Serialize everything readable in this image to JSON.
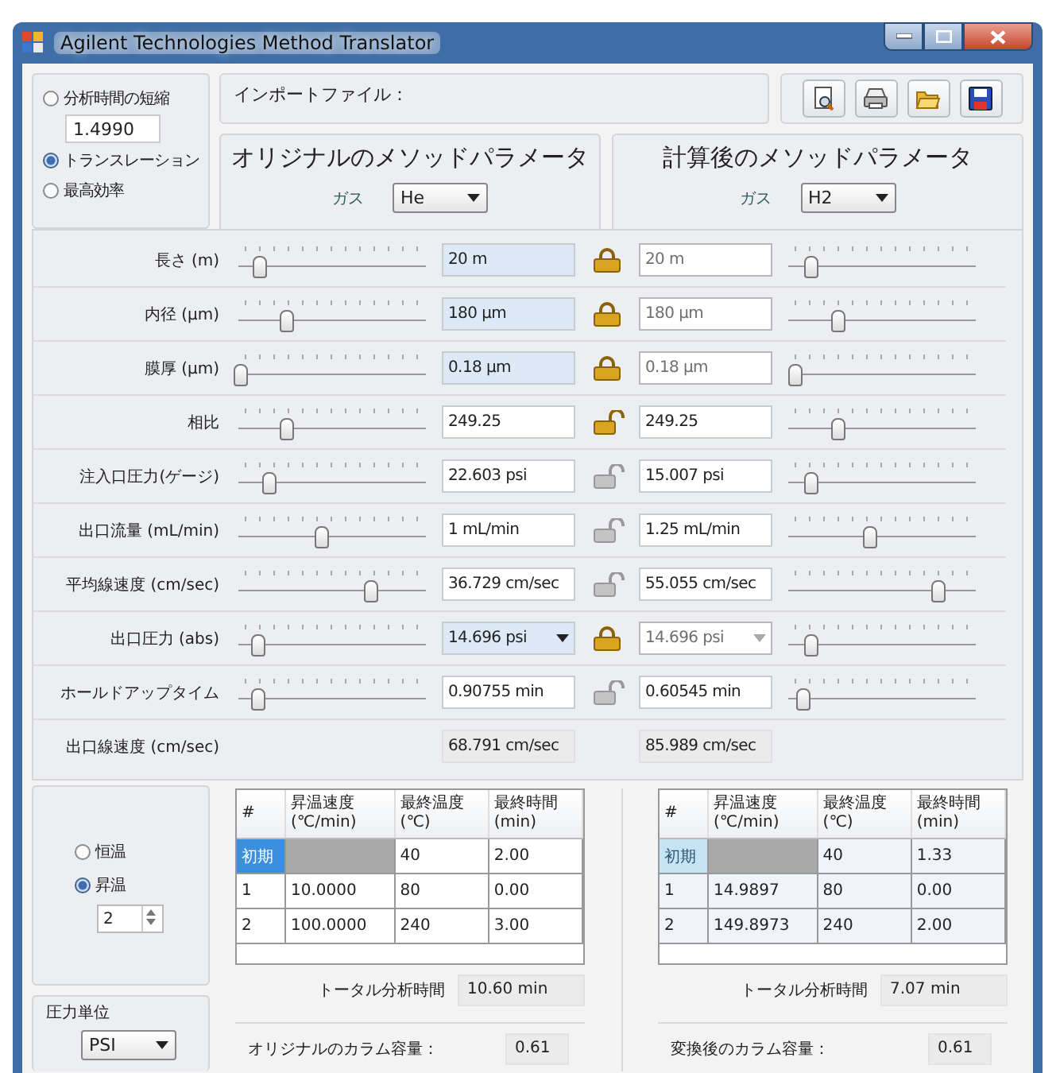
{
  "window": {
    "title": "Agilent Technologies Method Translator"
  },
  "mode_options": [
    {
      "label": "分析時間の短縮",
      "selected": false
    },
    {
      "label": "トランスレーション",
      "selected": true
    },
    {
      "label": "最高効率",
      "selected": false
    }
  ],
  "speed_factor": "1.4990",
  "import_file": {
    "label": "インポートファイル："
  },
  "toolbar": [
    {
      "kind": "preview"
    },
    {
      "kind": "print"
    },
    {
      "kind": "open"
    },
    {
      "kind": "save"
    }
  ],
  "original": {
    "title": "オリジナルのメソッドパラメータ",
    "gas_label": "ガス",
    "gas": "He"
  },
  "calculated": {
    "title": "計算後のメソッドパラメータ",
    "gas_label": "ガス",
    "gas": "H2"
  },
  "parameters": [
    {
      "kind": "slider",
      "label": "長さ (m)",
      "original": {
        "value": "20 m",
        "level": 0.11,
        "highlighted": true
      },
      "locked": true,
      "lock_disabled": false,
      "calculated": {
        "value": "20 m",
        "level": 0.12,
        "disabled": true
      }
    },
    {
      "kind": "slider",
      "label": "内径 (μm)",
      "original": {
        "value": "180 μm",
        "level": 0.25,
        "highlighted": true
      },
      "locked": true,
      "lock_disabled": false,
      "calculated": {
        "value": "180 μm",
        "level": 0.26,
        "disabled": true
      }
    },
    {
      "kind": "slider",
      "label": "膜厚 (μm)",
      "original": {
        "value": "0.18 μm",
        "level": 0.01,
        "highlighted": true
      },
      "locked": true,
      "lock_disabled": false,
      "calculated": {
        "value": "0.18 μm",
        "level": 0.03,
        "disabled": true
      }
    },
    {
      "kind": "slider",
      "label": "相比",
      "original": {
        "value": "249.25",
        "level": 0.25,
        "highlighted": false
      },
      "locked": false,
      "lock_disabled": false,
      "calculated": {
        "value": "249.25",
        "level": 0.26,
        "disabled": false
      }
    },
    {
      "kind": "slider",
      "label": "注入口圧力(ゲージ)",
      "original": {
        "value": "22.603 psi",
        "level": 0.16,
        "highlighted": false
      },
      "locked": false,
      "lock_disabled": true,
      "calculated": {
        "value": "15.007 psi",
        "level": 0.12,
        "disabled": false
      }
    },
    {
      "kind": "slider",
      "label": "出口流量 (mL/min)",
      "original": {
        "value": "1 mL/min",
        "level": 0.44,
        "highlighted": false
      },
      "locked": false,
      "lock_disabled": true,
      "calculated": {
        "value": "1.25 mL/min",
        "level": 0.43,
        "disabled": false
      }
    },
    {
      "kind": "slider",
      "label": "平均線速度 (cm/sec)",
      "original": {
        "value": "36.729 cm/sec",
        "level": 0.7,
        "highlighted": false
      },
      "locked": false,
      "lock_disabled": true,
      "calculated": {
        "value": "55.055 cm/sec",
        "level": 0.8,
        "disabled": false
      }
    },
    {
      "kind": "dropdown",
      "label": "出口圧力 (abs)",
      "original": {
        "value": "14.696 psi",
        "level": 0.1,
        "highlighted": true
      },
      "locked": true,
      "lock_disabled": false,
      "calculated": {
        "value": "14.696 psi",
        "level": 0.12,
        "disabled": true
      }
    },
    {
      "kind": "slider",
      "label": "ホールドアップタイム",
      "original": {
        "value": "0.90755 min",
        "level": 0.1,
        "highlighted": false
      },
      "locked": false,
      "lock_disabled": true,
      "calculated": {
        "value": "0.60545 min",
        "level": 0.08,
        "disabled": false
      }
    },
    {
      "kind": "readout",
      "label": "出口線速度 (cm/sec)",
      "original": {
        "value": "68.791 cm/sec"
      },
      "calculated": {
        "value": "85.989 cm/sec"
      }
    }
  ],
  "oven_modes": [
    {
      "label": "恒温",
      "selected": false
    },
    {
      "label": "昇温",
      "selected": true
    }
  ],
  "ramp_count": "2",
  "pressure_unit": {
    "label": "圧力単位",
    "value": "PSI"
  },
  "original_program": {
    "read_only": false,
    "columns": [
      "#",
      "昇温速度\n(℃/min)",
      "最終温度\n(℃)",
      "最終時間\n(min)"
    ],
    "rows": [
      {
        "cells": [
          "初期",
          null,
          "40",
          "2.00"
        ],
        "selected": true
      },
      {
        "cells": [
          "1",
          "10.0000",
          "80",
          "0.00"
        ],
        "selected": false
      },
      {
        "cells": [
          "2",
          "100.0000",
          "240",
          "3.00"
        ],
        "selected": false
      }
    ],
    "total_label": "トータル分析時間",
    "total": "10.60 min",
    "capacity_label": "オリジナルのカラム容量：",
    "capacity": "0.61"
  },
  "calculated_program": {
    "read_only": true,
    "columns": [
      "#",
      "昇温速度\n(℃/min)",
      "最終温度\n(℃)",
      "最終時間\n(min)"
    ],
    "rows": [
      {
        "cells": [
          "初期",
          null,
          "40",
          "1.33"
        ],
        "selected": true
      },
      {
        "cells": [
          "1",
          "14.9897",
          "80",
          "0.00"
        ],
        "selected": false
      },
      {
        "cells": [
          "2",
          "149.8973",
          "240",
          "2.00"
        ],
        "selected": false
      }
    ],
    "total_label": "トータル分析時間",
    "total": "7.07 min",
    "capacity_label": "変換後のカラム容量：",
    "capacity": "0.61"
  }
}
